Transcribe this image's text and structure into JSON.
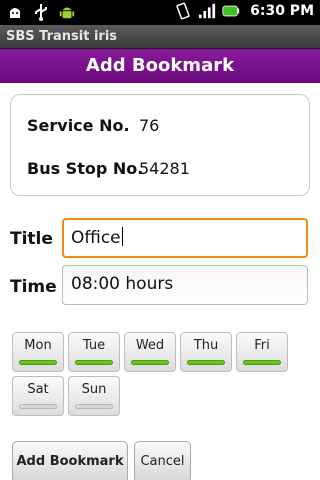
{
  "status_bar": {
    "time": "6:30 PM",
    "icons": [
      "android-debug-icon",
      "usb-icon",
      "android-robot-icon",
      "vibrate-icon",
      "signal-icon",
      "battery-icon"
    ]
  },
  "app": {
    "title": "SBS Transit iris"
  },
  "header": {
    "title": "Add Bookmark"
  },
  "info": {
    "service_label": "Service No.",
    "service_value": "76",
    "stop_label": "Bus Stop No.",
    "stop_value": "54281"
  },
  "form": {
    "title_label": "Title",
    "title_value": "Office",
    "time_label": "Time",
    "time_value": "08:00 hours"
  },
  "days": [
    {
      "label": "Mon",
      "selected": true
    },
    {
      "label": "Tue",
      "selected": true
    },
    {
      "label": "Wed",
      "selected": true
    },
    {
      "label": "Thu",
      "selected": true
    },
    {
      "label": "Fri",
      "selected": true
    },
    {
      "label": "Sat",
      "selected": false
    },
    {
      "label": "Sun",
      "selected": false
    }
  ],
  "buttons": {
    "add": "Add Bookmark",
    "cancel": "Cancel"
  },
  "colors": {
    "header": "#7a128c",
    "focus": "#f08a1a",
    "day_on": "#6ac41a"
  }
}
